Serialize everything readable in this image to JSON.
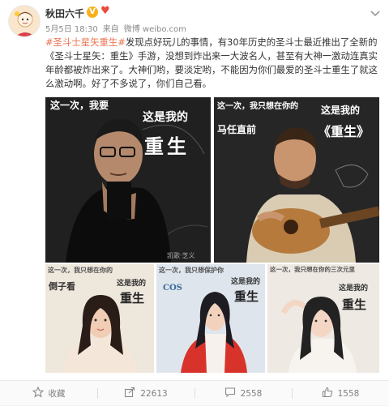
{
  "post": {
    "username": "秋田六千",
    "vip_badge": "V",
    "date": "5月5日 18:30",
    "source_prefix": "来自",
    "source": "微博 weibo.com",
    "text_parts": [
      {
        "type": "link",
        "text": "#圣斗士星矢重生#"
      },
      {
        "type": "text",
        "text": "发现点好玩儿的事情，有30年历史的圣斗士最近推出了全新的《圣斗士星矢：重生》手游，没想到炸出来一大波名人，甚至有大神一激动连真实年龄都被炸出来了。大神们哟，要淡定哟，不能因为你们最爱的圣斗士重生了就这么激动啊。好了不多说了，你们自己看。"
      }
    ]
  },
  "images": {
    "img1": {
      "line1": "这一次，我要",
      "line2": "这是我的",
      "line3": "重生",
      "signature": "凯歌·芝义"
    },
    "img2": {
      "line1": "这一次，我只想在你的",
      "line2": "马任直前",
      "line3": "这是我的",
      "line4": "《重生》"
    },
    "img3": {
      "line1": "这一次，我只想在你的",
      "line2": "倒子看",
      "line3": "这是我的",
      "line4": "重生"
    },
    "img4": {
      "line1": "这一次，我只想保护你",
      "line2": "COS",
      "line3": "这是我的",
      "line4": "重生"
    },
    "img5": {
      "line1": "这一次，我只想在你的三次元里",
      "line2": "这是我的",
      "line3": "重生"
    }
  },
  "actions": {
    "favorite": "收藏",
    "share_count": "22613",
    "comment_count": "2558",
    "like_count": "1558"
  },
  "colors": {
    "link": "#eb7350",
    "vip": "#f7b21b",
    "meta": "#8a8a8a"
  }
}
